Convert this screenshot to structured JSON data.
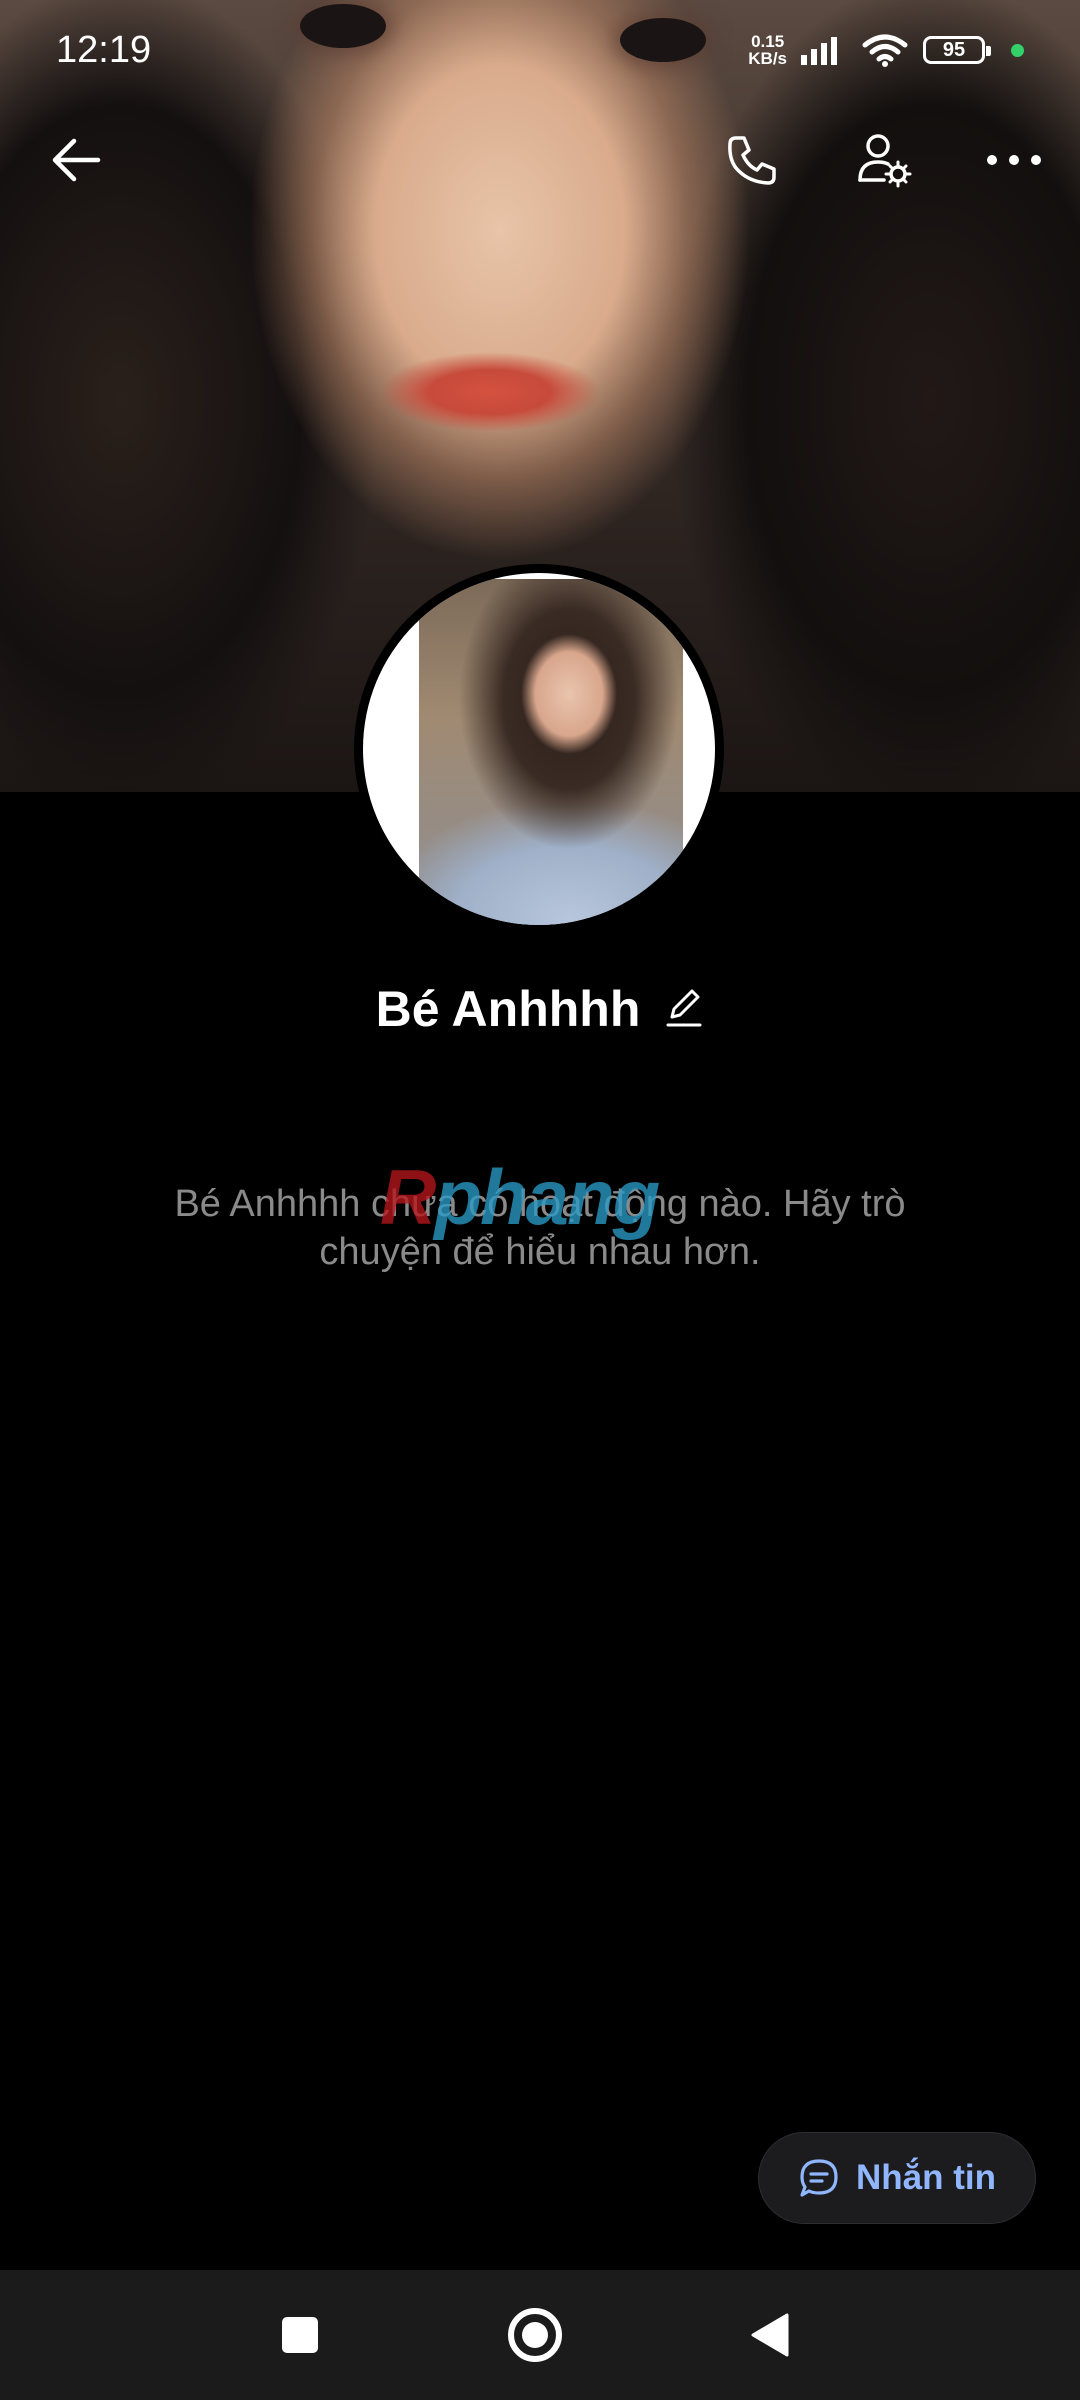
{
  "status_bar": {
    "time": "12:19",
    "net_speed_value": "0.15",
    "net_speed_unit": "KB/s",
    "battery": "95",
    "dot_color": "#33d06a"
  },
  "header": {
    "back_icon": "arrow-left-icon",
    "call_icon": "phone-icon",
    "settings_icon": "user-settings-icon",
    "more_icon": "more-dots-icon"
  },
  "profile": {
    "name": "Bé Anhhhh",
    "edit_icon": "pencil-icon",
    "empty_message": "Bé Anhhhh chưa có hoạt động nào. Hãy trò chuyện để hiểu nhau hơn."
  },
  "watermark": {
    "part1": "R",
    "part2": "phang"
  },
  "message_button": {
    "label": "Nhắn tin",
    "icon": "chat-bubble-icon",
    "color": "#8fb6ff"
  },
  "navbar": {
    "recents_icon": "square-icon",
    "home_icon": "circle-icon",
    "back_icon": "triangle-back-icon"
  }
}
